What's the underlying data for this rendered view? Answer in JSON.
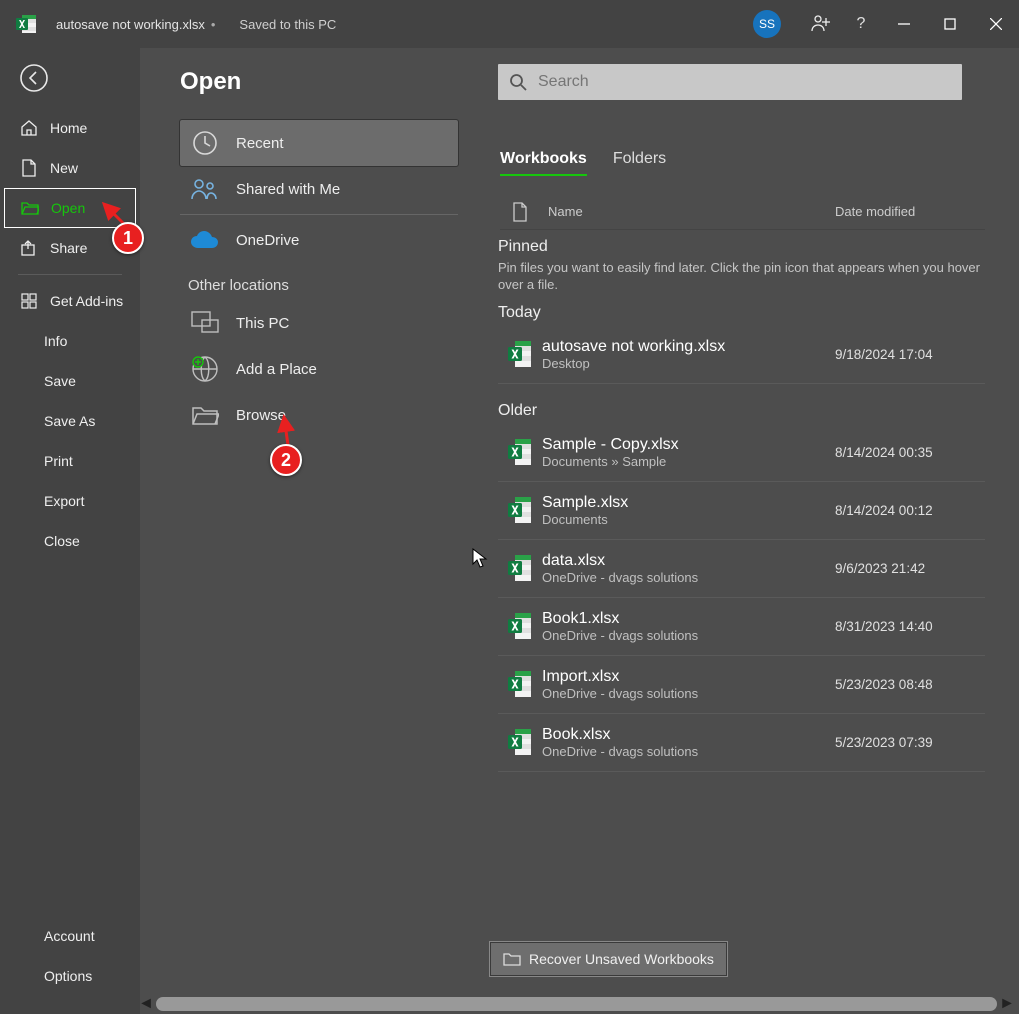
{
  "titlebar": {
    "filename": "autosave not working.xlsx",
    "status": "Saved to this PC",
    "user_initials": "SS"
  },
  "sidebar": {
    "home": "Home",
    "new": "New",
    "open": "Open",
    "share": "Share",
    "get_addins": "Get Add-ins",
    "info": "Info",
    "save": "Save",
    "save_as": "Save As",
    "print": "Print",
    "export": "Export",
    "close": "Close",
    "account": "Account",
    "options": "Options"
  },
  "page_title": "Open",
  "locations": {
    "recent": "Recent",
    "shared": "Shared with Me",
    "onedrive": "OneDrive",
    "other_label": "Other locations",
    "this_pc": "This PC",
    "add_place": "Add a Place",
    "browse": "Browse"
  },
  "search_placeholder": "Search",
  "tabs": {
    "workbooks": "Workbooks",
    "folders": "Folders"
  },
  "list_header": {
    "name": "Name",
    "date": "Date modified"
  },
  "pinned": {
    "label": "Pinned",
    "hint": "Pin files you want to easily find later. Click the pin icon that appears when you hover over a file."
  },
  "today_label": "Today",
  "older_label": "Older",
  "files_today": [
    {
      "name": "autosave not working.xlsx",
      "path": "Desktop",
      "date": "9/18/2024 17:04"
    }
  ],
  "files_older": [
    {
      "name": "Sample - Copy.xlsx",
      "path": "Documents » Sample",
      "date": "8/14/2024 00:35"
    },
    {
      "name": "Sample.xlsx",
      "path": "Documents",
      "date": "8/14/2024 00:12"
    },
    {
      "name": "data.xlsx",
      "path": "OneDrive - dvags solutions",
      "date": "9/6/2023 21:42"
    },
    {
      "name": "Book1.xlsx",
      "path": "OneDrive - dvags solutions",
      "date": "8/31/2023 14:40"
    },
    {
      "name": "Import.xlsx",
      "path": "OneDrive - dvags solutions",
      "date": "5/23/2023 08:48"
    },
    {
      "name": "Book.xlsx",
      "path": "OneDrive - dvags solutions",
      "date": "5/23/2023 07:39"
    }
  ],
  "recover_label": "Recover Unsaved Workbooks",
  "annotation": {
    "step1": "1",
    "step2": "2"
  }
}
